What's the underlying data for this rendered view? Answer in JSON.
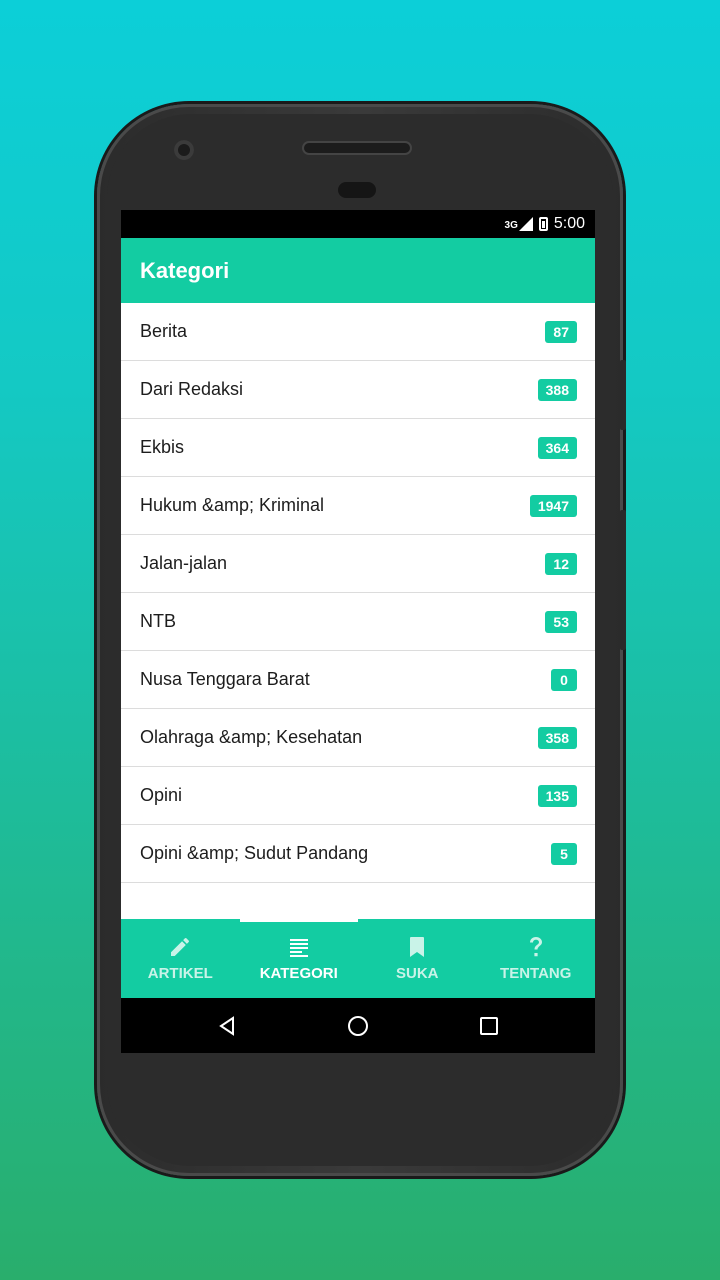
{
  "statusbar": {
    "network": "3G",
    "time": "5:00"
  },
  "appbar": {
    "title": "Kategori"
  },
  "categories": [
    {
      "label": "Berita",
      "count": "87"
    },
    {
      "label": "Dari Redaksi",
      "count": "388"
    },
    {
      "label": "Ekbis",
      "count": "364"
    },
    {
      "label": "Hukum &amp; Kriminal",
      "count": "1947"
    },
    {
      "label": "Jalan-jalan",
      "count": "12"
    },
    {
      "label": "NTB",
      "count": "53"
    },
    {
      "label": "Nusa Tenggara Barat",
      "count": "0"
    },
    {
      "label": "Olahraga &amp; Kesehatan",
      "count": "358"
    },
    {
      "label": "Opini",
      "count": "135"
    },
    {
      "label": "Opini &amp; Sudut Pandang",
      "count": "5"
    }
  ],
  "bottomnav": {
    "items": [
      {
        "label": "ARTIKEL",
        "icon": "pencil-icon"
      },
      {
        "label": "KATEGORI",
        "icon": "list-icon",
        "active": true
      },
      {
        "label": "SUKA",
        "icon": "bookmark-icon"
      },
      {
        "label": "TENTANG",
        "icon": "question-icon"
      }
    ]
  },
  "colors": {
    "accent": "#13cca2",
    "background_top": "#0ccfd8",
    "background_bottom": "#29ae6c"
  }
}
